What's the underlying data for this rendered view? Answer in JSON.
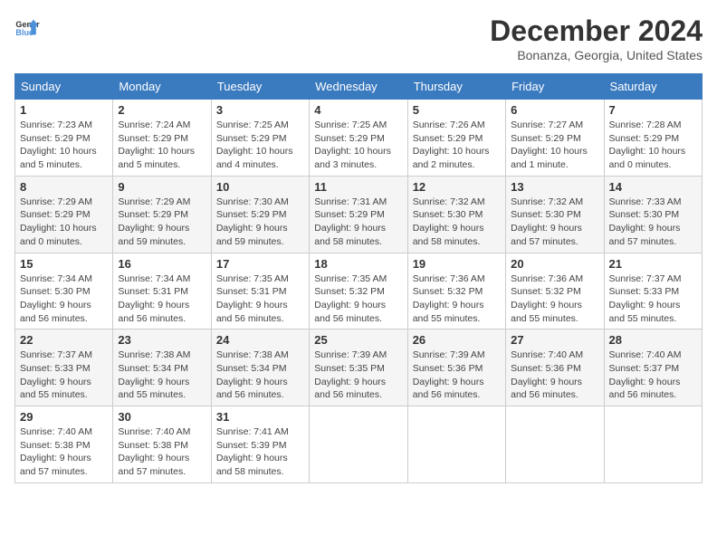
{
  "logo": {
    "line1": "General",
    "line2": "Blue"
  },
  "title": "December 2024",
  "location": "Bonanza, Georgia, United States",
  "headers": [
    "Sunday",
    "Monday",
    "Tuesday",
    "Wednesday",
    "Thursday",
    "Friday",
    "Saturday"
  ],
  "weeks": [
    [
      {
        "day": "1",
        "info": "Sunrise: 7:23 AM\nSunset: 5:29 PM\nDaylight: 10 hours\nand 5 minutes."
      },
      {
        "day": "2",
        "info": "Sunrise: 7:24 AM\nSunset: 5:29 PM\nDaylight: 10 hours\nand 5 minutes."
      },
      {
        "day": "3",
        "info": "Sunrise: 7:25 AM\nSunset: 5:29 PM\nDaylight: 10 hours\nand 4 minutes."
      },
      {
        "day": "4",
        "info": "Sunrise: 7:25 AM\nSunset: 5:29 PM\nDaylight: 10 hours\nand 3 minutes."
      },
      {
        "day": "5",
        "info": "Sunrise: 7:26 AM\nSunset: 5:29 PM\nDaylight: 10 hours\nand 2 minutes."
      },
      {
        "day": "6",
        "info": "Sunrise: 7:27 AM\nSunset: 5:29 PM\nDaylight: 10 hours\nand 1 minute."
      },
      {
        "day": "7",
        "info": "Sunrise: 7:28 AM\nSunset: 5:29 PM\nDaylight: 10 hours\nand 0 minutes."
      }
    ],
    [
      {
        "day": "8",
        "info": "Sunrise: 7:29 AM\nSunset: 5:29 PM\nDaylight: 10 hours\nand 0 minutes."
      },
      {
        "day": "9",
        "info": "Sunrise: 7:29 AM\nSunset: 5:29 PM\nDaylight: 9 hours\nand 59 minutes."
      },
      {
        "day": "10",
        "info": "Sunrise: 7:30 AM\nSunset: 5:29 PM\nDaylight: 9 hours\nand 59 minutes."
      },
      {
        "day": "11",
        "info": "Sunrise: 7:31 AM\nSunset: 5:29 PM\nDaylight: 9 hours\nand 58 minutes."
      },
      {
        "day": "12",
        "info": "Sunrise: 7:32 AM\nSunset: 5:30 PM\nDaylight: 9 hours\nand 58 minutes."
      },
      {
        "day": "13",
        "info": "Sunrise: 7:32 AM\nSunset: 5:30 PM\nDaylight: 9 hours\nand 57 minutes."
      },
      {
        "day": "14",
        "info": "Sunrise: 7:33 AM\nSunset: 5:30 PM\nDaylight: 9 hours\nand 57 minutes."
      }
    ],
    [
      {
        "day": "15",
        "info": "Sunrise: 7:34 AM\nSunset: 5:30 PM\nDaylight: 9 hours\nand 56 minutes."
      },
      {
        "day": "16",
        "info": "Sunrise: 7:34 AM\nSunset: 5:31 PM\nDaylight: 9 hours\nand 56 minutes."
      },
      {
        "day": "17",
        "info": "Sunrise: 7:35 AM\nSunset: 5:31 PM\nDaylight: 9 hours\nand 56 minutes."
      },
      {
        "day": "18",
        "info": "Sunrise: 7:35 AM\nSunset: 5:32 PM\nDaylight: 9 hours\nand 56 minutes."
      },
      {
        "day": "19",
        "info": "Sunrise: 7:36 AM\nSunset: 5:32 PM\nDaylight: 9 hours\nand 55 minutes."
      },
      {
        "day": "20",
        "info": "Sunrise: 7:36 AM\nSunset: 5:32 PM\nDaylight: 9 hours\nand 55 minutes."
      },
      {
        "day": "21",
        "info": "Sunrise: 7:37 AM\nSunset: 5:33 PM\nDaylight: 9 hours\nand 55 minutes."
      }
    ],
    [
      {
        "day": "22",
        "info": "Sunrise: 7:37 AM\nSunset: 5:33 PM\nDaylight: 9 hours\nand 55 minutes."
      },
      {
        "day": "23",
        "info": "Sunrise: 7:38 AM\nSunset: 5:34 PM\nDaylight: 9 hours\nand 55 minutes."
      },
      {
        "day": "24",
        "info": "Sunrise: 7:38 AM\nSunset: 5:34 PM\nDaylight: 9 hours\nand 56 minutes."
      },
      {
        "day": "25",
        "info": "Sunrise: 7:39 AM\nSunset: 5:35 PM\nDaylight: 9 hours\nand 56 minutes."
      },
      {
        "day": "26",
        "info": "Sunrise: 7:39 AM\nSunset: 5:36 PM\nDaylight: 9 hours\nand 56 minutes."
      },
      {
        "day": "27",
        "info": "Sunrise: 7:40 AM\nSunset: 5:36 PM\nDaylight: 9 hours\nand 56 minutes."
      },
      {
        "day": "28",
        "info": "Sunrise: 7:40 AM\nSunset: 5:37 PM\nDaylight: 9 hours\nand 56 minutes."
      }
    ],
    [
      {
        "day": "29",
        "info": "Sunrise: 7:40 AM\nSunset: 5:38 PM\nDaylight: 9 hours\nand 57 minutes."
      },
      {
        "day": "30",
        "info": "Sunrise: 7:40 AM\nSunset: 5:38 PM\nDaylight: 9 hours\nand 57 minutes."
      },
      {
        "day": "31",
        "info": "Sunrise: 7:41 AM\nSunset: 5:39 PM\nDaylight: 9 hours\nand 58 minutes."
      },
      {
        "day": "",
        "info": ""
      },
      {
        "day": "",
        "info": ""
      },
      {
        "day": "",
        "info": ""
      },
      {
        "day": "",
        "info": ""
      }
    ]
  ]
}
